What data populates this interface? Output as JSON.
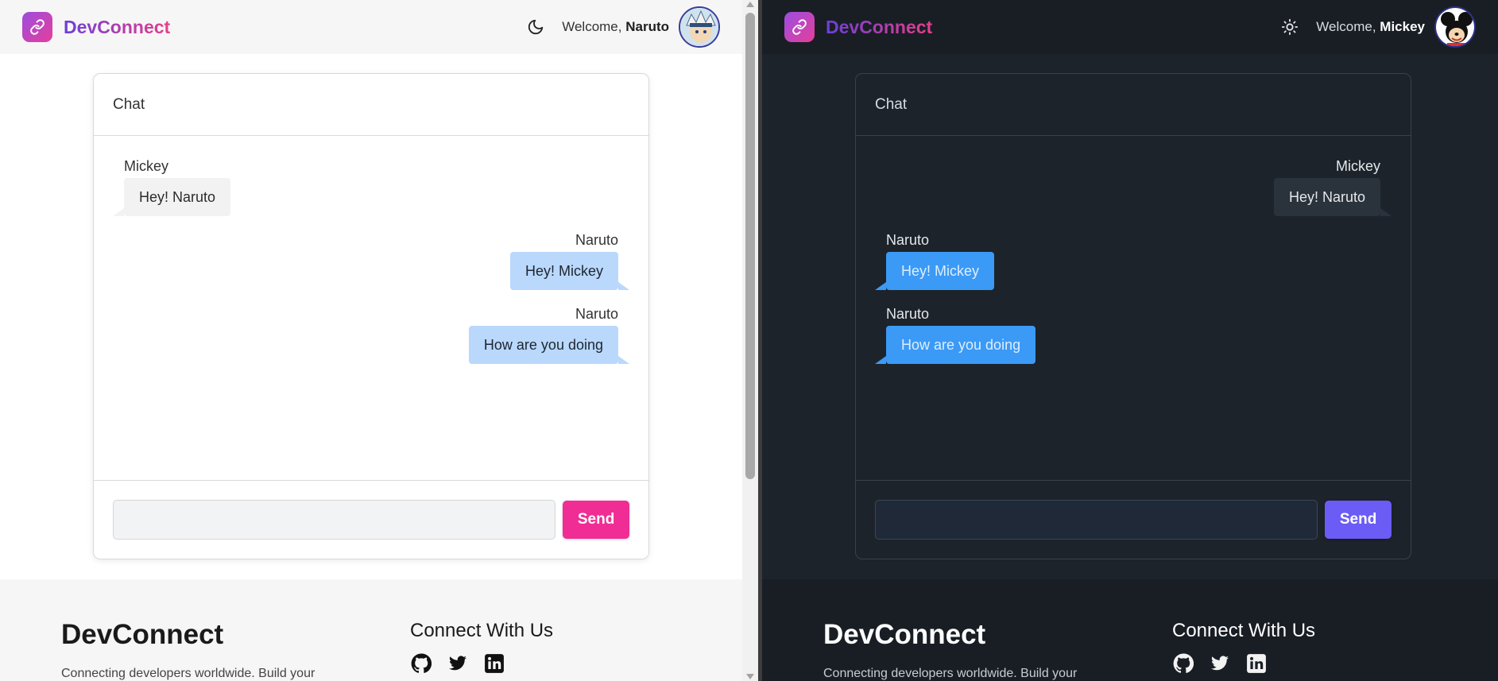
{
  "light": {
    "navbar": {
      "brand": "DevConnect",
      "welcome_prefix": "Welcome,",
      "username": "Naruto",
      "theme_icon": "moon-icon"
    },
    "chat": {
      "title": "Chat",
      "messages": [
        {
          "sender": "Mickey",
          "text": "Hey! Naruto",
          "side": "left"
        },
        {
          "sender": "Naruto",
          "text": "Hey! Mickey",
          "side": "right"
        },
        {
          "sender": "Naruto",
          "text": "How are you doing",
          "side": "right"
        }
      ],
      "input_value": "",
      "send_label": "Send"
    },
    "footer": {
      "brand": "DevConnect",
      "tagline": "Connecting developers worldwide. Build your",
      "connect_title": "Connect With Us",
      "social": [
        "github-icon",
        "twitter-icon",
        "linkedin-icon"
      ]
    },
    "colors": {
      "send": "#f02d94",
      "bubble_own": "#b9d8fc",
      "bubble_other": "#f2f2f2"
    }
  },
  "dark": {
    "navbar": {
      "brand": "DevConnect",
      "welcome_prefix": "Welcome,",
      "username": "Mickey",
      "theme_icon": "sun-icon"
    },
    "chat": {
      "title": "Chat",
      "messages": [
        {
          "sender": "Mickey",
          "text": "Hey! Naruto",
          "side": "right"
        },
        {
          "sender": "Naruto",
          "text": "Hey! Mickey",
          "side": "left"
        },
        {
          "sender": "Naruto",
          "text": "How are you doing",
          "side": "left"
        }
      ],
      "input_value": "",
      "send_label": "Send"
    },
    "footer": {
      "brand": "DevConnect",
      "tagline": "Connecting developers worldwide. Build your",
      "connect_title": "Connect With Us",
      "social": [
        "github-icon",
        "twitter-icon",
        "linkedin-icon"
      ]
    },
    "colors": {
      "send": "#6b5cf6",
      "bubble_own": "#2a323c",
      "bubble_other": "#3b9af6"
    }
  }
}
